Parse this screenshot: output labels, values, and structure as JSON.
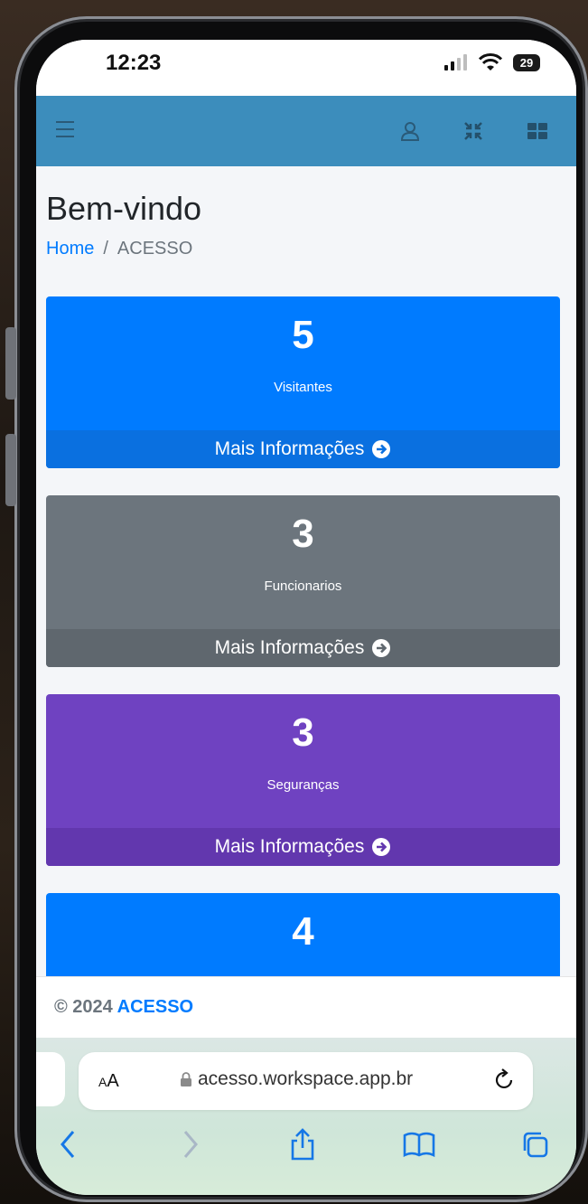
{
  "status_bar": {
    "time": "12:23",
    "battery": "29"
  },
  "topbar": {
    "menu_icon": "hamburger-menu-icon",
    "user_icon": "user-icon",
    "collapse_icon": "compress-icon",
    "apps_icon": "grid-icon"
  },
  "page": {
    "title": "Bem-vindo",
    "breadcrumb": {
      "home": "Home",
      "separator": "/",
      "current": "ACESSO"
    }
  },
  "cards": [
    {
      "value": "5",
      "label": "Visitantes",
      "more": "Mais Informações",
      "color": "#007bff"
    },
    {
      "value": "3",
      "label": "Funcionarios",
      "more": "Mais Informações",
      "color": "#6c757d"
    },
    {
      "value": "3",
      "label": "Seguranças",
      "more": "Mais Informações",
      "color": "#6f42c1"
    },
    {
      "value": "4",
      "color": "#007bff"
    }
  ],
  "footer": {
    "copyright": "© 2024",
    "brand": "ACESSO"
  },
  "browser": {
    "text_size": "AA",
    "url": "acesso.workspace.app.br"
  },
  "colors": {
    "topbar": "#3c8dbc",
    "link": "#007bff"
  }
}
